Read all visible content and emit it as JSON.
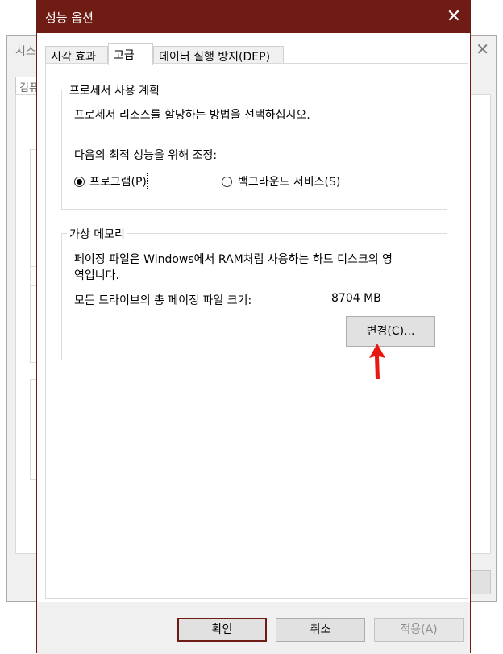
{
  "background_window": {
    "title": "시스",
    "tab_label": "컴퓨"
  },
  "dialog": {
    "title": "성능 옵션",
    "close_icon": "close-icon",
    "tabs": [
      {
        "label": "시각 효과"
      },
      {
        "label": "고급"
      },
      {
        "label": "데이터 실행 방지(DEP)"
      }
    ],
    "active_tab": "고급"
  },
  "processor": {
    "group_title": "프로세서 사용 계획",
    "description": "프로세서 리소스를 할당하는 방법을 선택하십시오.",
    "adjust_label": "다음의 최적 성능을 위해 조정:",
    "options": [
      {
        "label": "프로그램(P)",
        "checked": true
      },
      {
        "label": "백그라운드 서비스(S)",
        "checked": false
      }
    ]
  },
  "virtual_memory": {
    "group_title": "가상 메모리",
    "description_line1": "페이징 파일은 Windows에서 RAM처럼 사용하는 하드 디스크의 영",
    "description_line2": "역입니다.",
    "total_label": "모든 드라이브의 총 페이징 파일 크기:",
    "total_value": "8704 MB",
    "change_button": "변경(C)..."
  },
  "footer": {
    "ok": "확인",
    "cancel": "취소",
    "apply": "적용(A)"
  },
  "annotation": {
    "arrow_color": "#e8170f"
  }
}
